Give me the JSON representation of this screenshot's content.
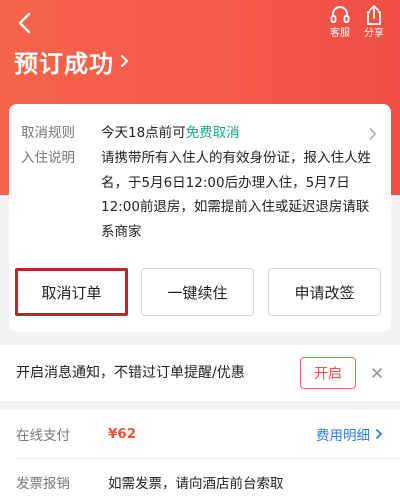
{
  "header": {
    "title": "预订成功",
    "service_label": "客服",
    "share_label": "分享"
  },
  "card": {
    "rule_label": "取消规则",
    "rule_prefix": "今天18点前可",
    "rule_free": "免费取消",
    "checkin_label": "入住说明",
    "checkin_text": "请携带所有入住人的有效身份证，报入住人姓名，于5月6日12:00后办理入住，5月7日12:00前退房，如需提前入住或延迟退房请联系商家"
  },
  "actions": {
    "cancel_label": "取消订单",
    "renew_label": "一键续住",
    "change_label": "申请改签"
  },
  "notice": {
    "text": "开启消息通知，不错过订单提醒/优惠",
    "open_label": "开启"
  },
  "payment": {
    "online_label": "在线支付",
    "amount": "¥62",
    "detail_label": "费用明细",
    "invoice_label": "发票报销",
    "invoice_text": "如需发票，请向酒店前台索取"
  },
  "colors": {
    "header_start": "#f7634a",
    "header_end": "#f04e46",
    "accent_red": "#f0533f",
    "free_green": "#1aa98a",
    "link_blue": "#2a7ee0",
    "highlight_border": "#b22a2a"
  }
}
